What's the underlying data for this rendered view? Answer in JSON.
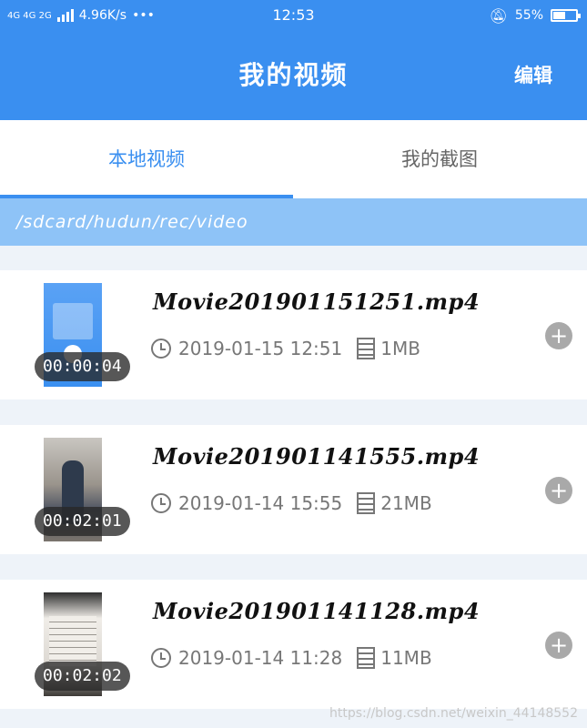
{
  "status_bar": {
    "network": "4G 4G 2G",
    "speed": "4.96K/s",
    "more": "•••",
    "time": "12:53",
    "battery": "55%",
    "battery_level": 0.55
  },
  "header": {
    "title": "我的视频",
    "edit_label": "编辑"
  },
  "tabs": [
    {
      "label": "本地视频",
      "active": true
    },
    {
      "label": "我的截图",
      "active": false
    }
  ],
  "path": "/sdcard/hudun/rec/video",
  "videos": [
    {
      "name": "Movie201901151251.mp4",
      "date": "2019-01-15 12:51",
      "size": "1MB",
      "duration": "00:00:04"
    },
    {
      "name": "Movie201901141555.mp4",
      "date": "2019-01-14 15:55",
      "size": "21MB",
      "duration": "00:02:01"
    },
    {
      "name": "Movie201901141128.mp4",
      "date": "2019-01-14 11:28",
      "size": "11MB",
      "duration": "00:02:02"
    }
  ],
  "icons": {
    "clock": "clock-icon",
    "file": "file-icon",
    "add": "plus-icon",
    "bell": "bell-off-icon",
    "battery": "battery-icon"
  },
  "colors": {
    "primary": "#3a8ff0",
    "path_bar": "#8ec3f7"
  },
  "watermark": "https://blog.csdn.net/weixin_44148552"
}
